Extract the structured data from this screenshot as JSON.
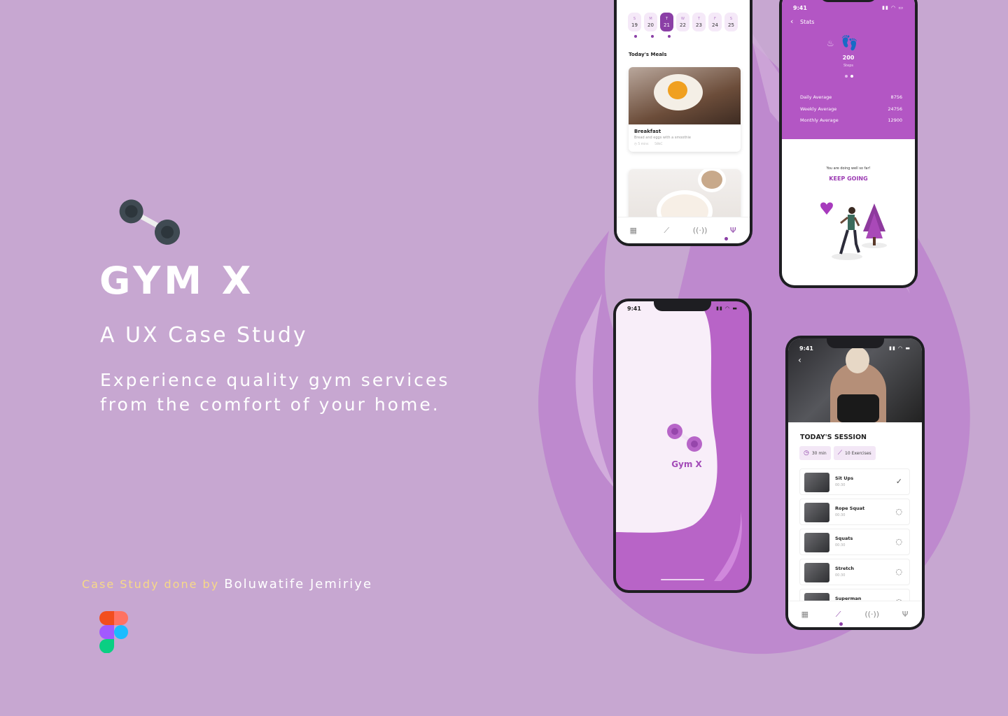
{
  "hero": {
    "brand": "GYM X",
    "subtitle": "A UX Case Study",
    "tagline_line1": "Experience quality gym services",
    "tagline_line2": "from the comfort of your home.",
    "credit_prefix": "Case Study done by",
    "credit_author": "Boluwatife Jemiriye",
    "logo_icon": "dumbbell-icon",
    "tool_icon": "figma-logo"
  },
  "colors": {
    "background": "#c7a7d1",
    "accent": "#b356c4",
    "accent_dark": "#8b3fa6",
    "credit": "#f7d987"
  },
  "meals_screen": {
    "days": [
      {
        "letter": "S",
        "num": "19"
      },
      {
        "letter": "M",
        "num": "20"
      },
      {
        "letter": "T",
        "num": "21"
      },
      {
        "letter": "W",
        "num": "22"
      },
      {
        "letter": "T",
        "num": "23"
      },
      {
        "letter": "F",
        "num": "24"
      },
      {
        "letter": "S",
        "num": "25"
      }
    ],
    "active_day": "21",
    "section_title": "Today's Meals",
    "meal_name": "Breakfast",
    "meal_desc": "Bread and eggs with a smoothie",
    "meal_time": "5 mins",
    "meal_kcal": "58kC",
    "tabs": [
      "dashboard-icon",
      "dumbbell-icon",
      "broadcast-icon",
      "cutlery-icon"
    ]
  },
  "stats_screen": {
    "time": "9:41",
    "title": "Stats",
    "steps_value": "200",
    "steps_label": "Steps",
    "daily_label": "Daily Average",
    "daily_value": "8756",
    "weekly_label": "Weekly Average",
    "weekly_value": "24756",
    "monthly_label": "Monthly Average",
    "monthly_value": "12900",
    "message": "You are doing well so far!",
    "cta": "KEEP GOING"
  },
  "splash_screen": {
    "time": "9:41",
    "app_name": "Gym X"
  },
  "session_screen": {
    "time": "9:41",
    "title": "TODAY'S SESSION",
    "duration": "30 min",
    "exercise_count": "10 Exercises",
    "exercises": [
      {
        "name": "Sit Ups",
        "time": "00:30",
        "state": "done"
      },
      {
        "name": "Rope Squat",
        "time": "00:30",
        "state": "pending"
      },
      {
        "name": "Squats",
        "time": "00:30",
        "state": "pending"
      },
      {
        "name": "Stretch",
        "time": "00:30",
        "state": "pending"
      },
      {
        "name": "Superman",
        "time": "",
        "state": "pending"
      }
    ]
  }
}
